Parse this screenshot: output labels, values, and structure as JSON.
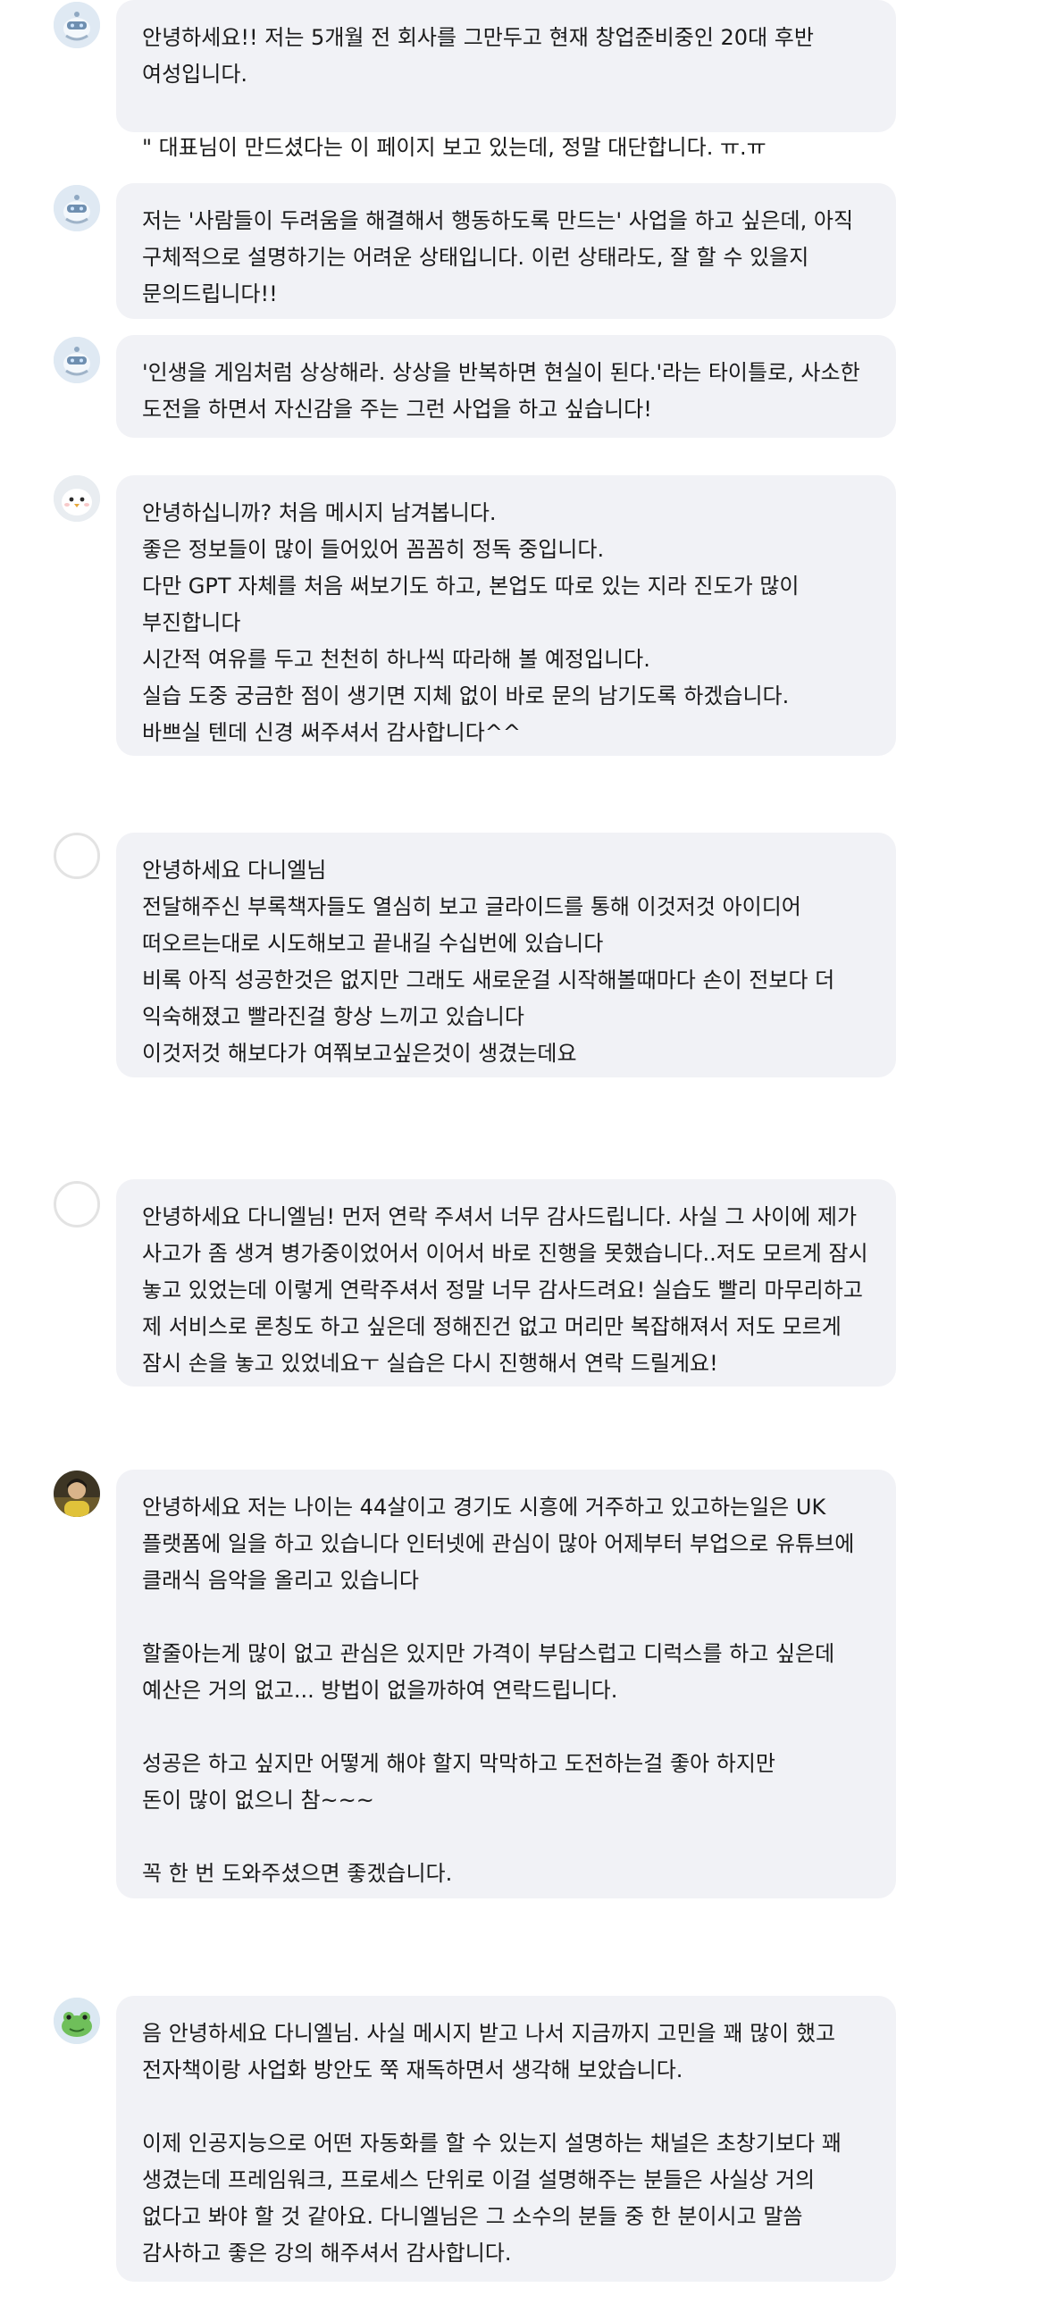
{
  "messages": [
    {
      "avatar": "robot-avatar",
      "paragraphs": [
        "안녕하세요!! 저는 5개월 전 회사를 그만두고 현재 창업준비중인 20대 후반 여성입니다.",
        "\" 대표님이 만드셨다는 이 페이지 보고 있는데, 정말 대단합니다. ㅠ.ㅠ"
      ]
    },
    {
      "avatar": "robot-avatar",
      "paragraphs": [
        "저는 '사람들이 두려움을 해결해서 행동하도록 만드는' 사업을 하고 싶은데, 아직 구체적으로 설명하기는 어려운 상태입니다. 이런 상태라도, 잘 할 수 있을지 문의드립니다!!"
      ]
    },
    {
      "avatar": "robot-avatar",
      "paragraphs": [
        "'인생을 게임처럼 상상해라. 상상을 반복하면 현실이 된다.'라는 타이틀로, 사소한 도전을 하면서 자신감을 주는 그런 사업을 하고 싶습니다!"
      ]
    },
    {
      "avatar": "bird-avatar",
      "paragraphs": [
        "안녕하십니까? 처음 메시지 남겨봅니다.\n좋은 정보들이 많이 들어있어 꼼꼼히 정독 중입니다.\n다만 GPT 자체를 처음 써보기도 하고, 본업도 따로 있는 지라 진도가 많이 부진합니다\n시간적 여유를 두고 천천히 하나씩 따라해 볼 예정입니다.\n실습 도중 궁금한 점이 생기면 지체 없이 바로 문의 남기도록 하겠습니다.\n바쁘실 텐데 신경 써주셔서 감사합니다^^"
      ]
    },
    {
      "avatar": "default-avatar",
      "paragraphs": [
        "안녕하세요 다니엘님\n전달해주신 부록책자들도 열심히 보고 글라이드를 통해 이것저것 아이디어 떠오르는대로 시도해보고 끝내길 수십번에 있습니다\n비록 아직 성공한것은 없지만 그래도 새로운걸 시작해볼때마다 손이 전보다 더 익숙해졌고 빨라진걸 항상 느끼고 있습니다\n이것저것 해보다가 여쭤보고싶은것이 생겼는데요"
      ]
    },
    {
      "avatar": "default-avatar",
      "paragraphs": [
        "안녕하세요 다니엘님! 먼저 연락 주셔서 너무 감사드립니다. 사실 그 사이에 제가 사고가 좀 생겨 병가중이었어서 이어서 바로 진행을 못했습니다..저도 모르게 잠시 놓고 있었는데 이렇게 연락주셔서 정말 너무 감사드려요! 실습도 빨리 마무리하고 제 서비스로 론칭도 하고 싶은데 정해진건 없고 머리만 복잡해져서 저도 모르게 잠시 손을 놓고 있었네요ㅜ 실습은 다시 진행해서 연락 드릴게요!"
      ]
    },
    {
      "avatar": "photo-avatar",
      "paragraphs": [
        "안녕하세요 저는 나이는 44살이고 경기도 시흥에 거주하고 있고하는일은 UK 플랫폼에 일을 하고 있습니다 인터넷에 관심이 많아 어제부터 부업으로 유튜브에 클래식 음악을 올리고 있습니다",
        "할줄아는게 많이 없고 관심은 있지만 가격이 부담스럽고 디럭스를 하고 싶은데 예산은 거의 없고... 방법이 없을까하여 연락드립니다.",
        "성공은 하고 싶지만 어떻게 해야 할지 막막하고 도전하는걸 좋아 하지만\n돈이 많이 없으니 참~~~",
        "꼭 한 번 도와주셨으면 좋겠습니다."
      ]
    },
    {
      "avatar": "frog-avatar",
      "paragraphs": [
        "음 안녕하세요 다니엘님. 사실 메시지 받고 나서 지금까지 고민을 꽤 많이 했고 전자책이랑 사업화 방안도 쭉 재독하면서 생각해 보았습니다.",
        "이제 인공지능으로 어떤 자동화를 할 수 있는지 설명하는 채널은 초창기보다 꽤 생겼는데 프레임워크, 프로세스 단위로 이걸 설명해주는 분들은 사실상 거의 없다고 봐야 할 것 같아요. 다니엘님은 그 소수의 분들 중 한 분이시고 말씀 감사하고 좋은 강의 해주셔서 감사합니다."
      ]
    }
  ]
}
